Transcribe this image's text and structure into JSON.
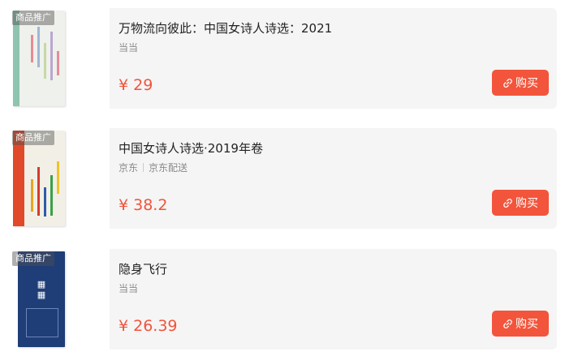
{
  "products": [
    {
      "badge": "商品推广",
      "title": "万物流向彼此：中国女诗人诗选：2021",
      "store": "当当",
      "delivery": "",
      "price": "¥ 29",
      "button_label": "购买",
      "button_icon": "link-icon"
    },
    {
      "badge": "商品推广",
      "title": "中国女诗人诗选·2019年卷",
      "store": "京东",
      "delivery": "京东配送",
      "price": "¥ 38.2",
      "button_label": "购买",
      "button_icon": "link-icon"
    },
    {
      "badge": "商品推广",
      "title": "隐身飞行",
      "store": "当当",
      "delivery": "",
      "price": "¥ 26.39",
      "button_label": "购买",
      "button_icon": "link-icon"
    }
  ],
  "colors": {
    "accent": "#f2553b",
    "price": "#f2533b",
    "card_bg": "#f5f5f5"
  }
}
